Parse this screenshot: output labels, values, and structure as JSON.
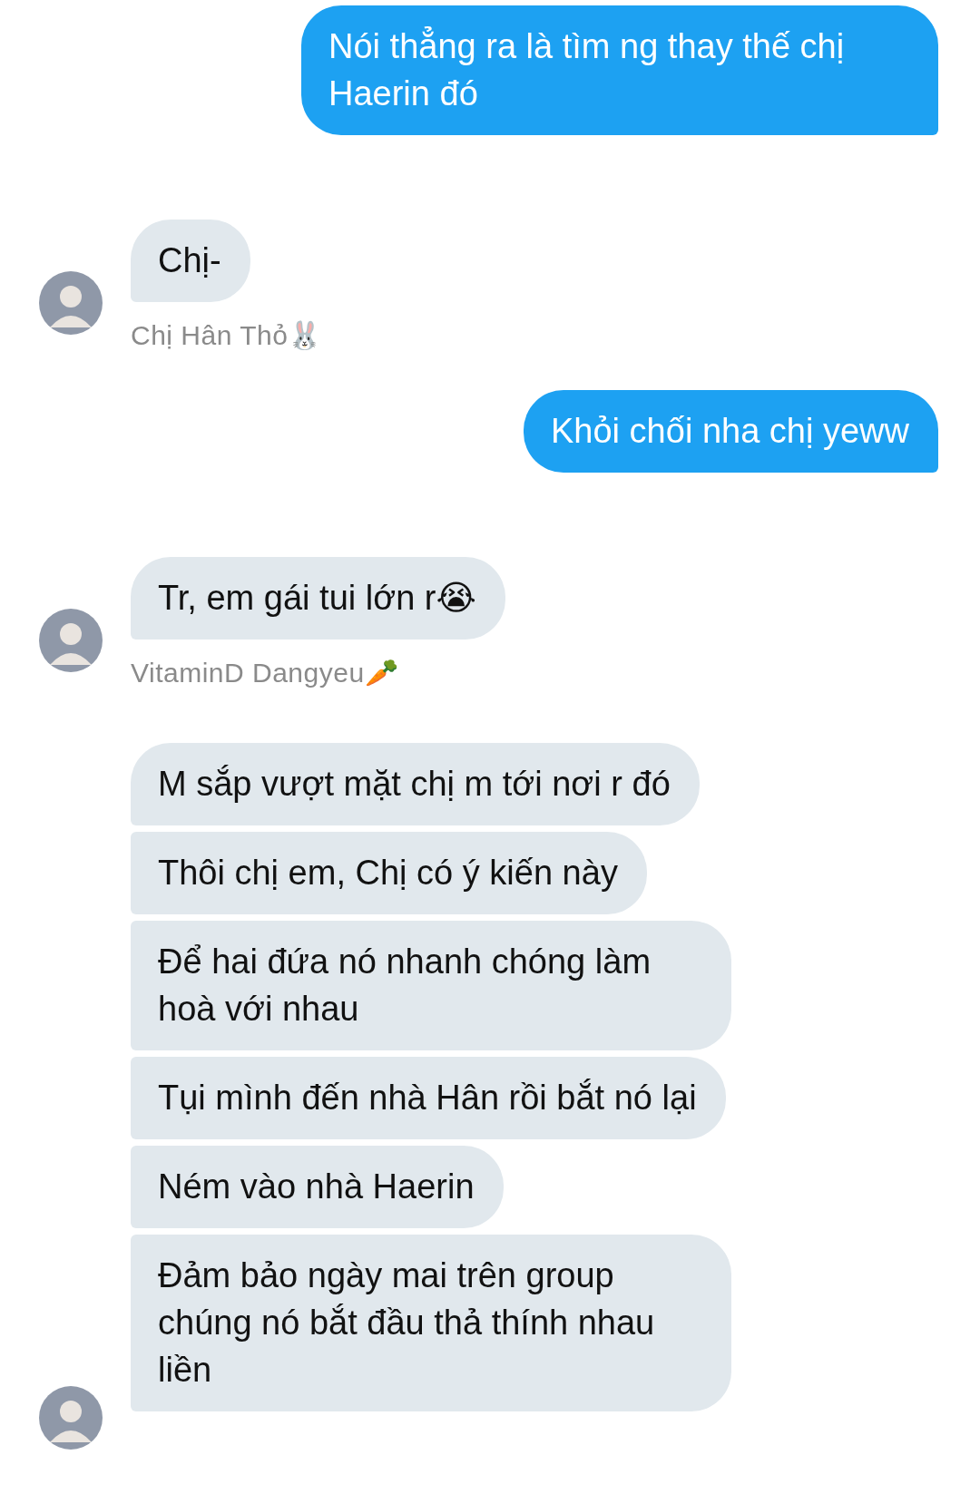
{
  "messages": [
    {
      "kind": "outgoing",
      "bubbles": [
        "Nói thẳng ra là tìm ng thay thế chị Haerin đó"
      ]
    },
    {
      "kind": "incoming",
      "bubbles": [
        "Chị-"
      ],
      "sender": "Chị Hân Thỏ🐰"
    },
    {
      "kind": "outgoing",
      "bubbles": [
        "Khỏi chối nha chị yeww"
      ]
    },
    {
      "kind": "incoming",
      "bubbles": [
        "Tr, em gái tui lớn r😭"
      ],
      "sender": "VitaminD Dangyeu🥕"
    },
    {
      "kind": "incoming",
      "bubbles": [
        "M sắp vượt mặt chị m tới nơi r đó",
        "Thôi chị em, Chị có ý kiến này",
        "Để hai đứa nó nhanh chóng làm hoà với nhau",
        "Tụi mình đến nhà Hân rồi bắt nó lại",
        "Ném vào nhà Haerin",
        "Đảm bảo ngày mai trên group chúng nó bắt đầu thả thính nhau liền"
      ]
    }
  ]
}
